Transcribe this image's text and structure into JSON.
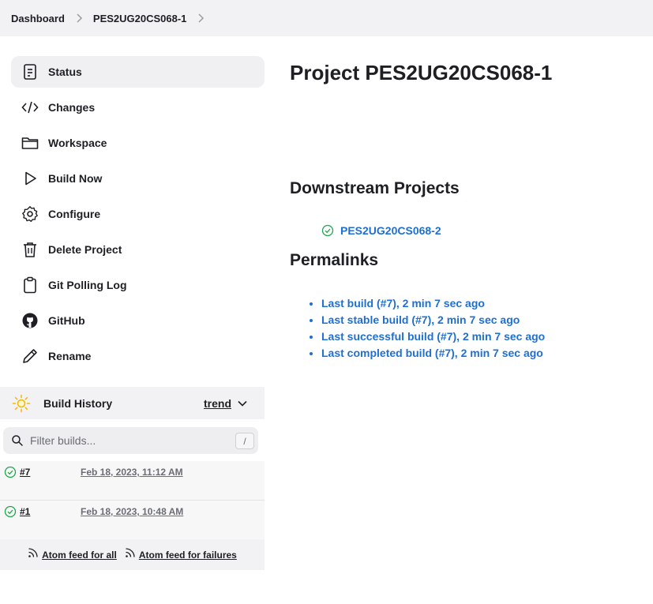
{
  "breadcrumb": {
    "items": [
      "Dashboard",
      "PES2UG20CS068-1"
    ]
  },
  "sidebar": {
    "items": [
      {
        "label": "Status",
        "icon": "document-icon"
      },
      {
        "label": "Changes",
        "icon": "code-icon"
      },
      {
        "label": "Workspace",
        "icon": "folder-icon"
      },
      {
        "label": "Build Now",
        "icon": "play-icon"
      },
      {
        "label": "Configure",
        "icon": "gear-icon"
      },
      {
        "label": "Delete Project",
        "icon": "trash-icon"
      },
      {
        "label": "Git Polling Log",
        "icon": "clipboard-icon"
      },
      {
        "label": "GitHub",
        "icon": "github-icon"
      },
      {
        "label": "Rename",
        "icon": "pencil-icon"
      }
    ]
  },
  "build_history": {
    "title": "Build History",
    "trend_label": "trend",
    "filter_placeholder": "Filter builds...",
    "filter_shortcut": "/",
    "builds": [
      {
        "number": "#7",
        "date": "Feb 18, 2023, 11:12 AM",
        "status": "success"
      },
      {
        "number": "#1",
        "date": "Feb 18, 2023, 10:48 AM",
        "status": "success"
      }
    ],
    "feeds": {
      "all": "Atom feed for all",
      "failures": "Atom feed for failures"
    }
  },
  "main": {
    "title": "Project PES2UG20CS068-1",
    "downstream_heading": "Downstream Projects",
    "downstream_projects": [
      "PES2UG20CS068-2"
    ],
    "permalinks_heading": "Permalinks",
    "permalinks": [
      "Last build (#7), 2 min 7 sec ago",
      "Last stable build (#7), 2 min 7 sec ago",
      "Last successful build (#7), 2 min 7 sec ago",
      "Last completed build (#7), 2 min 7 sec ago"
    ]
  },
  "colors": {
    "link": "#1f6fd1",
    "success": "#1ea64b",
    "panel": "#f2f2f4"
  }
}
